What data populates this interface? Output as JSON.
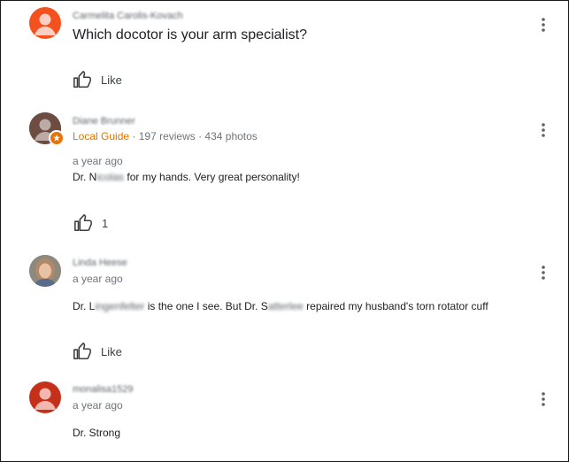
{
  "posts": [
    {
      "author": "Carmelita Carolis-Kovach",
      "text": "Which docotor is your arm specialist?",
      "like_label": "Like"
    },
    {
      "author": "Diane Brunner",
      "badge": "Local Guide",
      "stats_sep1": " · ",
      "reviews": "197 reviews",
      "stats_sep2": " · ",
      "photos": "434 photos",
      "time": "a year ago",
      "text_a": "Dr. N",
      "text_blur": "icolas",
      "text_b": " for my hands. Very great personality!",
      "like_count": "1"
    },
    {
      "author": "Linda Heese",
      "time": "a year ago",
      "text_a": "Dr. L",
      "text_blur1": "ingenfelter",
      "text_b": " is the one I see. But Dr. S",
      "text_blur2": "atterlee",
      "text_c": " repaired my husband's torn rotator cuff",
      "like_label": "Like"
    },
    {
      "author": "monalisa1529",
      "time": "a year ago",
      "text": "Dr. Strong"
    }
  ],
  "colors": {
    "avatar_orange": "#f4511e",
    "avatar_brown": "#5d4037",
    "avatar_red": "#c5301b",
    "local_guide": "#e37400"
  }
}
